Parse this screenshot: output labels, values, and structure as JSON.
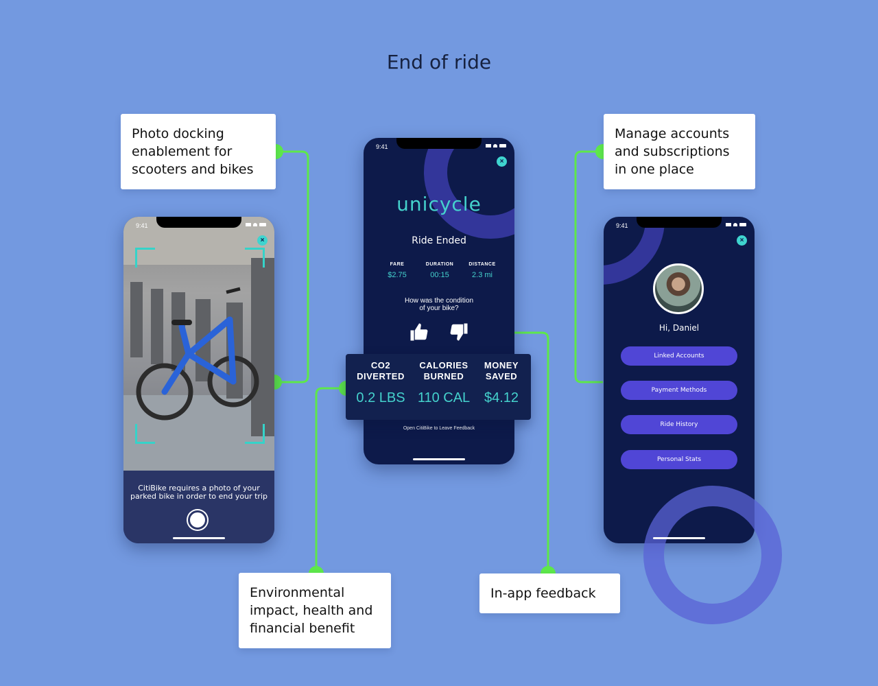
{
  "title": "End of ride",
  "callouts": {
    "photo_docking": "Photo docking enablement for scooters and bikes",
    "accounts": "Manage accounts and subscriptions in one place",
    "environmental": "Environmental impact, health and financial benefit",
    "feedback": "In-app feedback"
  },
  "phone_camera": {
    "time": "9:41",
    "caption_line1": "CitiBike requires a photo of your",
    "caption_line2": "parked bike in order to end your trip"
  },
  "phone_ride": {
    "time": "9:41",
    "logo": "unicycle",
    "heading": "Ride Ended",
    "stats": [
      {
        "label": "FARE",
        "value": "$2.75"
      },
      {
        "label": "DURATION",
        "value": "00:15"
      },
      {
        "label": "DISTANCE",
        "value": "2.3 mi"
      }
    ],
    "question_line1": "How was the condition",
    "question_line2": "of your bike?",
    "feedback_link": "Open CitiBike to Leave Feedback"
  },
  "impact": [
    {
      "label_line1": "CO2",
      "label_line2": "DIVERTED",
      "value": "0.2 LBS"
    },
    {
      "label_line1": "CALORIES",
      "label_line2": "BURNED",
      "value": "110 CAL"
    },
    {
      "label_line1": "MONEY",
      "label_line2": "SAVED",
      "value": "$4.12"
    }
  ],
  "phone_account": {
    "time": "9:41",
    "greeting": "Hi, Daniel",
    "menu": [
      "Linked Accounts",
      "Payment Methods",
      "Ride History",
      "Personal Stats"
    ]
  },
  "colors": {
    "background": "#7399e0",
    "accent_teal": "#45d2cd",
    "connector_green": "#5ee84a",
    "button_purple": "#5046d6",
    "phone_navy": "#0d1a4a"
  }
}
